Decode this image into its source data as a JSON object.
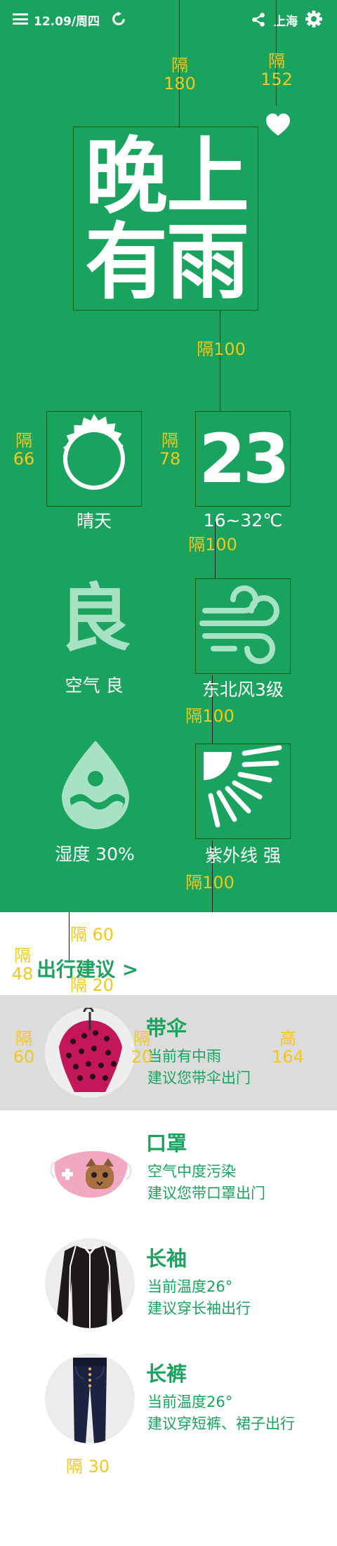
{
  "topbar": {
    "date": "12.09/周四",
    "city": "上海"
  },
  "colors": {
    "green": "#1aa35e",
    "annotation": "#f2c81a",
    "highlight": "#dcdcdc",
    "faded_icon": "#a8e2c4"
  },
  "icons": [
    "menu-icon",
    "refresh-icon",
    "share-icon",
    "gear-icon",
    "heart-icon",
    "sun-icon",
    "wind-icon",
    "water-drop-icon",
    "sunshine-icon"
  ],
  "headline": {
    "line1": "晚上",
    "line2": "有雨"
  },
  "weather": {
    "condition": "晴天",
    "temperature": "23",
    "range": "16~32℃"
  },
  "air": {
    "glyph": "良",
    "label": "空气 良"
  },
  "wind": {
    "label": "东北风3级"
  },
  "humidity": {
    "label": "湿度 30%"
  },
  "uv": {
    "label": "紫外线 强"
  },
  "advice": {
    "title": "出行建议 >",
    "items": [
      {
        "name": "带伞",
        "line1": "当前有中雨",
        "line2": "建议您带伞出门"
      },
      {
        "name": "口罩",
        "line1": "空气中度污染",
        "line2": "建议您带口罩出门"
      },
      {
        "name": "长袖",
        "line1": "当前温度26°",
        "line2": "建议穿长袖出行"
      },
      {
        "name": "长裤",
        "line1": "当前温度26°",
        "line2": "建议穿短裤、裙子出行"
      }
    ]
  },
  "annotations": {
    "gap": "隔",
    "v180": "180",
    "v152": "152",
    "gap100": "隔100",
    "v66": "66",
    "v78": "78",
    "gap60": "隔 60",
    "v48": "48",
    "gap20": "隔 20",
    "v60": "60",
    "v20": "20",
    "height": "高",
    "v164": "164",
    "gap30": "隔 30"
  }
}
